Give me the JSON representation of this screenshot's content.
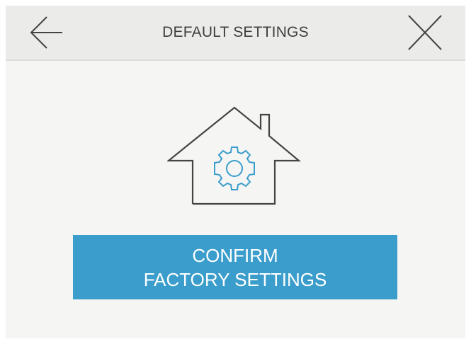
{
  "header": {
    "title": "DEFAULT SETTINGS",
    "back_icon": "arrow-left-icon",
    "close_icon": "close-icon"
  },
  "illustration": {
    "icon": "house-gear-icon",
    "colors": {
      "house_outline": "#444444",
      "gear": "#3a9dcb"
    }
  },
  "confirm_button": {
    "line1": "CONFIRM",
    "line2": "FACTORY SETTINGS",
    "color": "#3a9dcb"
  }
}
